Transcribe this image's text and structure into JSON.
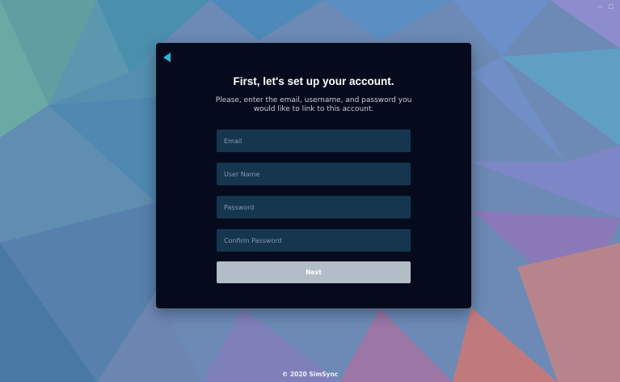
{
  "background": {
    "colors": [
      "#4f8fa0",
      "#5a86b6",
      "#7d83c4",
      "#a07aa8",
      "#c7787a",
      "#6fa7b7"
    ]
  },
  "window_controls": {
    "text": "— □"
  },
  "card": {
    "back_icon": "back-triangle-icon",
    "accent": "#29b6d8",
    "title": "First, let's set up your account.",
    "subtitle": "Please, enter the email, username, and password you would like to link to this account.",
    "fields": {
      "email_placeholder": "Email",
      "username_placeholder": "User Name",
      "password_placeholder": "Password",
      "confirm_placeholder": "Confirm Password"
    },
    "next_label": "Next"
  },
  "footer": {
    "text": "© 2020 SimSync"
  }
}
